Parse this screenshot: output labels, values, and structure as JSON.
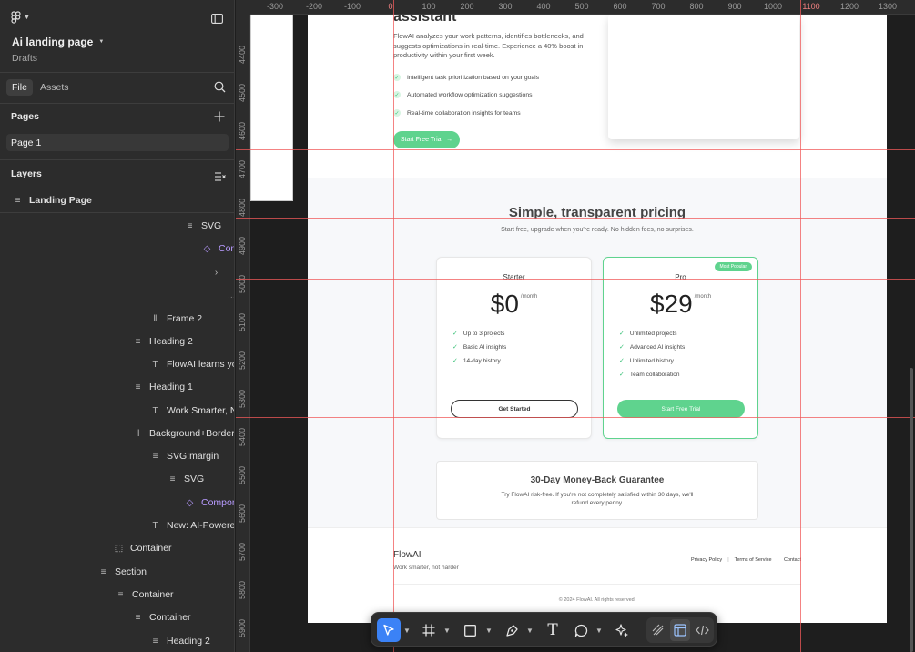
{
  "app": {
    "file_name": "Ai landing page",
    "location": "Drafts"
  },
  "panel_tabs": [
    "File",
    "Assets"
  ],
  "pages": {
    "header": "Pages",
    "items": [
      "Page 1"
    ]
  },
  "layers": {
    "header": "Layers",
    "root": "Landing Page",
    "items": [
      {
        "label": "SVG",
        "kind": "frame"
      },
      {
        "label": "Com",
        "kind": "component"
      },
      {
        "label": "",
        "kind": "chevron"
      },
      {
        "label": "...",
        "kind": "dim"
      },
      {
        "label": "Frame 2",
        "kind": "autolayout"
      },
      {
        "label": "Heading 2",
        "kind": "frame"
      },
      {
        "label": "FlowAI learns you",
        "kind": "text"
      },
      {
        "label": "Heading 1",
        "kind": "frame"
      },
      {
        "label": "Work Smarter, No",
        "kind": "text"
      },
      {
        "label": "Background+Border",
        "kind": "autolayout"
      },
      {
        "label": "SVG:margin",
        "kind": "frame"
      },
      {
        "label": "SVG",
        "kind": "frame"
      },
      {
        "label": "Compone",
        "kind": "component"
      },
      {
        "label": "New: AI-Powered",
        "kind": "text"
      },
      {
        "label": "Container",
        "kind": "group"
      },
      {
        "label": "Section",
        "kind": "frame"
      },
      {
        "label": "Container",
        "kind": "frame"
      },
      {
        "label": "Container",
        "kind": "frame"
      },
      {
        "label": "Heading 2",
        "kind": "frame"
      }
    ]
  },
  "rulers": {
    "horizontal": [
      "-300",
      "-200",
      "-100",
      "0",
      "100",
      "200",
      "300",
      "400",
      "500",
      "600",
      "700",
      "800",
      "900",
      "1000",
      "1100",
      "1200",
      "1300"
    ],
    "vertical": [
      "4400",
      "4500",
      "4600",
      "4700",
      "4800",
      "4900",
      "5000",
      "5100",
      "5200",
      "5300",
      "5400",
      "5500",
      "5600",
      "5700",
      "5800",
      "5900"
    ]
  },
  "landing": {
    "hero_heading": "assistant",
    "hero_desc": "FlowAI analyzes your work patterns, identifies bottlenecks, and suggests optimizations in real-time. Experience a 40% boost in productivity within your first week.",
    "features": [
      "Intelligent task prioritization based on your goals",
      "Automated workflow optimization suggestions",
      "Real-time collaboration insights for teams"
    ],
    "cta": "Start Free Trial",
    "cta_arrow": "→",
    "pricing_title": "Simple, transparent pricing",
    "pricing_sub": "Start free, upgrade when you're ready. No hidden fees, no surprises.",
    "plans": [
      {
        "name": "Starter",
        "price": "$0",
        "period": "/month",
        "features": [
          "Up to 3 projects",
          "Basic AI insights",
          "14-day history"
        ],
        "button": "Get Started"
      },
      {
        "name": "Pro",
        "price": "$29",
        "period": "/month",
        "badge": "Most Popular",
        "features": [
          "Unlimited projects",
          "Advanced AI insights",
          "Unlimited history",
          "Team collaboration"
        ],
        "button": "Start Free Trial"
      }
    ],
    "guarantee_title": "30-Day Money-Back Guarantee",
    "guarantee_desc": "Try FlowAI risk-free. If you're not completely satisfied within 30 days, we'll refund every penny.",
    "footer": {
      "brand": "FlowAI",
      "tagline": "Work smarter, not harder",
      "links": [
        "Privacy Policy",
        "Terms of Service",
        "Contact"
      ],
      "copyright": "© 2024 FlowAI. All rights reserved."
    }
  },
  "toolbar": [
    "move-tool",
    "frame-tool",
    "rectangle-tool",
    "pen-tool",
    "text-tool",
    "comment-tool",
    "actions-tool",
    "draw-mode",
    "design-mode",
    "dev-mode"
  ],
  "colors": {
    "accent": "#5fd38e",
    "selection": "#3b82f6",
    "guide": "#f05a5a",
    "component": "#b89bff"
  }
}
